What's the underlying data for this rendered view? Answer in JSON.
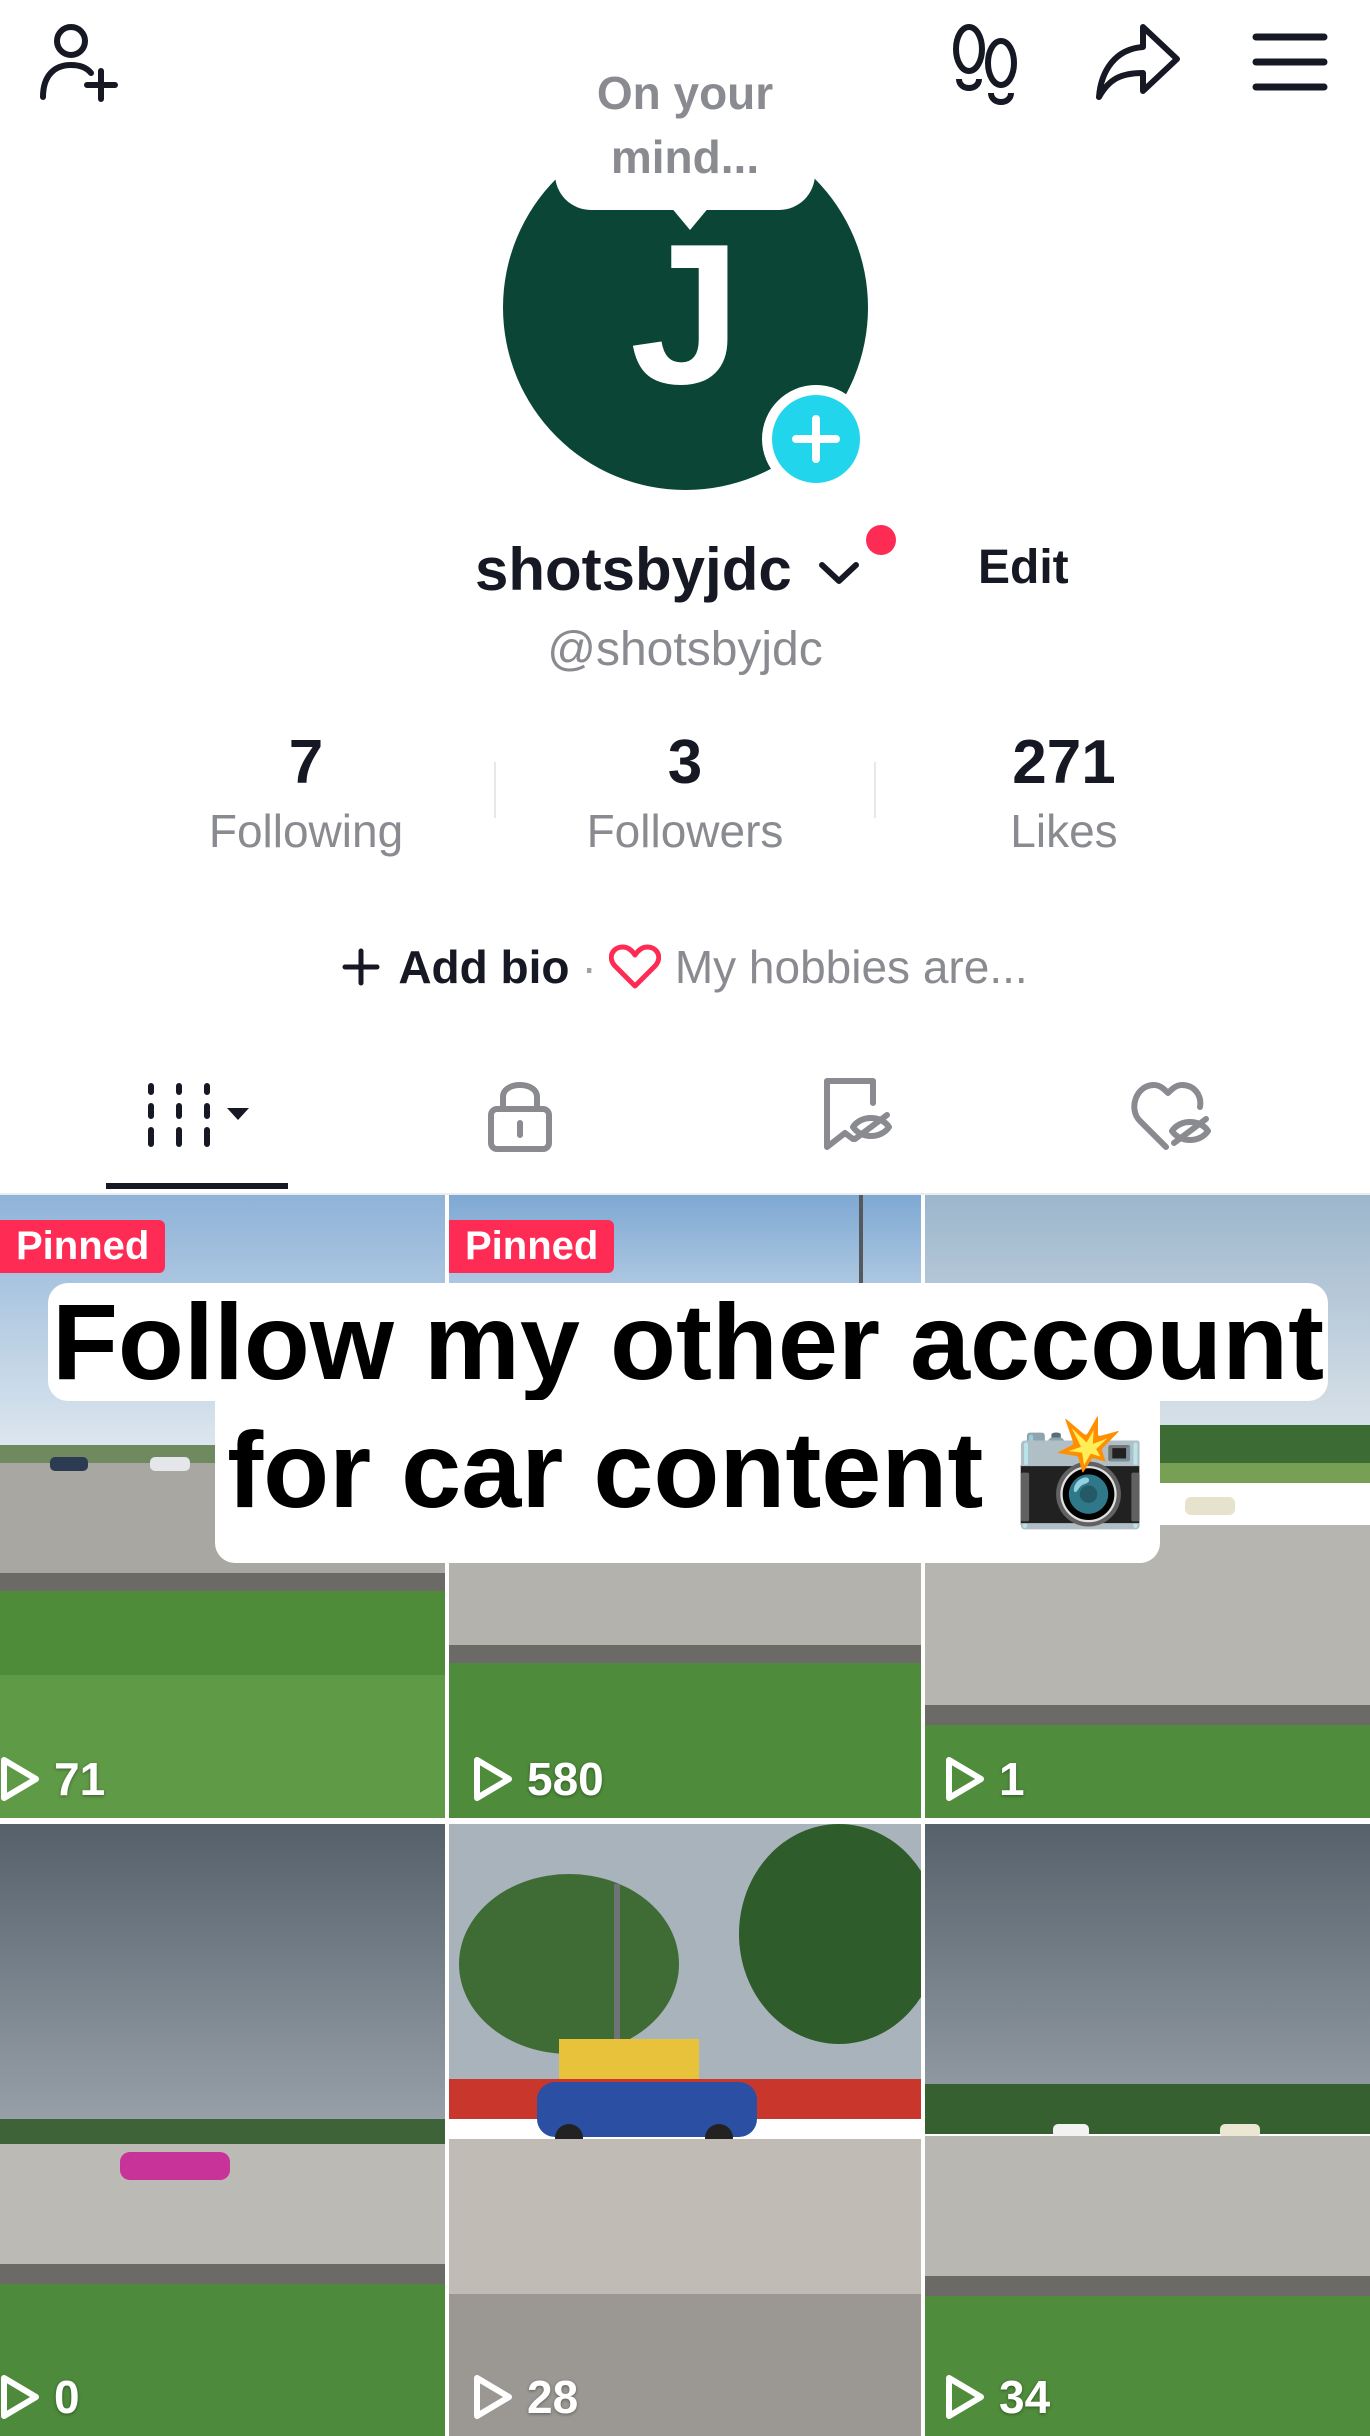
{
  "header": {
    "icons": [
      "add-friend-icon",
      "footprints-icon",
      "share-icon",
      "menu-icon"
    ]
  },
  "profile": {
    "bubble_text": "On your mind...",
    "avatar_letter": "J",
    "avatar_color": "#0b4536",
    "username": "shotsbyjdc",
    "edit_label": "Edit",
    "handle": "@shotsbyjdc"
  },
  "stats": [
    {
      "value": "7",
      "label": "Following"
    },
    {
      "value": "3",
      "label": "Followers"
    },
    {
      "value": "271",
      "label": "Likes"
    }
  ],
  "bio": {
    "add_label": "Add bio",
    "separator": "·",
    "hobbies_placeholder": "My hobbies are..."
  },
  "tabs": [
    "videos-grid-icon",
    "lock-icon",
    "bookmark-hidden-icon",
    "liked-hidden-icon"
  ],
  "videos": [
    {
      "pinned": "Pinned",
      "views": "71"
    },
    {
      "pinned": "Pinned",
      "views": "580"
    },
    {
      "pinned": "",
      "views": "1"
    },
    {
      "pinned": "",
      "views": "0"
    },
    {
      "pinned": "",
      "views": "28"
    },
    {
      "pinned": "",
      "views": "34"
    }
  ],
  "overlay": {
    "line1": "Follow my other account",
    "line2": "for car content 📸"
  },
  "colors": {
    "accent": "#fe2c55",
    "add_button": "#20d5ec",
    "muted_text": "#8a8b91"
  }
}
